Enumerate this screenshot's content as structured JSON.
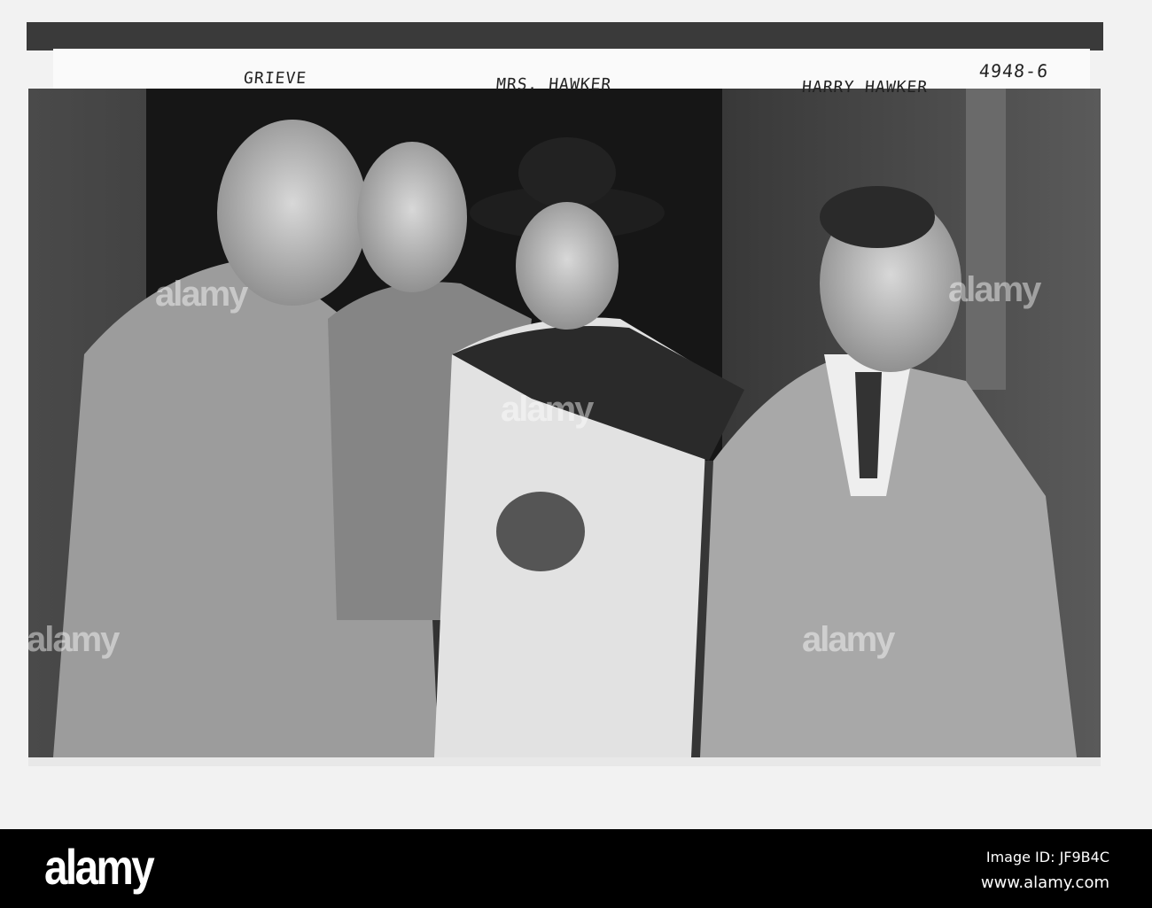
{
  "photo": {
    "captions": {
      "left": "GRIEVE",
      "center": "MRS. HAWKER",
      "right": "HARRY HAWKER",
      "negative_number": "4948-6"
    },
    "watermark": "alamy"
  },
  "footer": {
    "logo": "alamy",
    "image_id": "Image ID: JF9B4C",
    "url": "www.alamy.com"
  }
}
